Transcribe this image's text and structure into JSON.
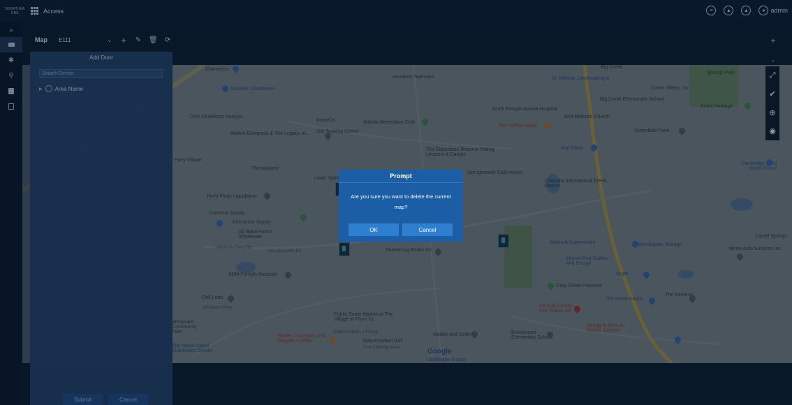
{
  "topbar": {
    "logo_text": "SIGNATURA ONE",
    "app_title": "Access",
    "user": "admin",
    "icons": [
      "chat-icon",
      "bell-icon",
      "alarm-icon",
      "user-icon"
    ]
  },
  "rail": {
    "collapse_label": "»",
    "items": [
      "door-icon",
      "settings-icon",
      "person-icon",
      "document-icon",
      "device-icon"
    ]
  },
  "toolbar": {
    "map_label": "Map",
    "map_select_value": "E111",
    "dropdown_glyph": "⌄",
    "add_glyph": "+",
    "edit_glyph": "✎",
    "delete_glyph": "🗑",
    "refresh_glyph": "⟳"
  },
  "panel": {
    "title": "Add Door",
    "search_placeholder": "Search Device",
    "tree_root": "Area Name",
    "submit_label": "Submit",
    "cancel_label": "Cancel"
  },
  "map": {
    "labels": [
      {
        "text": "Chemetics",
        "kind": "plain"
      },
      {
        "text": "Superior Distribution",
        "kind": "blue"
      },
      {
        "text": "Southern Staircase",
        "kind": "plain"
      },
      {
        "text": "BL Millman Landscaping &",
        "kind": "blue"
      },
      {
        "text": "Big Creek",
        "kind": "plain"
      },
      {
        "text": "Big Creek Elementary School",
        "kind": "plain"
      },
      {
        "text": "Cotter Sitters, Inc",
        "kind": "plain"
      },
      {
        "text": "Springs Park",
        "kind": "plain"
      },
      {
        "text": "Johns Heritage",
        "kind": "plain"
      },
      {
        "text": "CMX CineBistro Halcyon",
        "kind": "plain"
      },
      {
        "text": "Walton Bluegrass & The Legacy at...",
        "kind": "plain"
      },
      {
        "text": "RaiseOx",
        "kind": "plain"
      },
      {
        "text": "GM Training Center",
        "kind": "plain"
      },
      {
        "text": "Atlanta Recreation Club",
        "kind": "plain"
      },
      {
        "text": "South Forsyth Animal Hospital",
        "kind": "plain"
      },
      {
        "text": "The Coffee Lodge",
        "kind": "red"
      },
      {
        "text": "Bird-Bedrock Church",
        "kind": "plain"
      },
      {
        "text": "Greenfield Farm",
        "kind": "plain"
      },
      {
        "text": "Fairy Village",
        "kind": "plain"
      },
      {
        "text": "Therapyland",
        "kind": "plain"
      },
      {
        "text": "Laser Spine",
        "kind": "plain"
      },
      {
        "text": "The Equestrian Reserve Riding Lessons & Camps",
        "kind": "plain"
      },
      {
        "text": "Springmeade Club House",
        "kind": "plain"
      },
      {
        "text": "Any Glass",
        "kind": "blue"
      },
      {
        "text": "Cambridge Hard Wood Floors",
        "kind": "blue"
      },
      {
        "text": "Cherians International Fresh Market",
        "kind": "plain"
      },
      {
        "text": "Perfe Finds Liquidation",
        "kind": "plain"
      },
      {
        "text": "Lummus Supply",
        "kind": "plain"
      },
      {
        "text": "Johnstone Supply",
        "kind": "plain"
      },
      {
        "text": "All Baba Farms Wholesale",
        "kind": "plain"
      },
      {
        "text": "McGinnis Ferry Rd",
        "kind": "road"
      },
      {
        "text": "Old Alpharetta Rd",
        "kind": "road"
      },
      {
        "text": "Shelterring Books Inc",
        "kind": "plain"
      },
      {
        "text": "Walmart Supercenter",
        "kind": "blue"
      },
      {
        "text": "Morningstar Storage",
        "kind": "blue"
      },
      {
        "text": "Laurel Springs",
        "kind": "plain"
      },
      {
        "text": "Metro Auto Services Inc",
        "kind": "plain"
      },
      {
        "text": "Atlanta Rug Gallery And Design",
        "kind": "blue"
      },
      {
        "text": "Target",
        "kind": "blue"
      },
      {
        "text": "Grey Creek Preserve",
        "kind": "plain"
      },
      {
        "text": "The Home Depot",
        "kind": "blue"
      },
      {
        "text": "The Reserve",
        "kind": "plain"
      },
      {
        "text": "Forsyth County Fire Station #8",
        "kind": "red"
      },
      {
        "text": "Sprigg-N-Bites by Mamsi Savoyer",
        "kind": "red"
      },
      {
        "text": "ADM Forsyth Services",
        "kind": "plain"
      },
      {
        "text": "Chill Lotte",
        "kind": "plain"
      },
      {
        "text": "Windward Pkwy",
        "kind": "road"
      },
      {
        "text": "Windward Community Park",
        "kind": "plain"
      },
      {
        "text": "The Home Depot Distribution Center",
        "kind": "blue"
      },
      {
        "text": "Publix Super Market at The Village at Flynn Cr...",
        "kind": "plain"
      },
      {
        "text": "Publix Delivery • Pickup",
        "kind": "road"
      },
      {
        "text": "Bottles Cupcakes and Beignet Truffles",
        "kind": "red"
      },
      {
        "text": "Mayuri Indian Grill",
        "kind": "plain"
      },
      {
        "text": "Fast Catering Menu",
        "kind": "road"
      },
      {
        "text": "Marble and Order",
        "kind": "plain"
      },
      {
        "text": "Brookwood Elementary School",
        "kind": "plain"
      },
      {
        "text": "Google",
        "kind": "blue"
      },
      {
        "text": "Landscape Supply",
        "kind": "blue"
      }
    ]
  },
  "map_tools": [
    "fullscreen-icon",
    "check-icon",
    "plus-circle-icon",
    "locate-icon"
  ],
  "zoom": {
    "in": "+",
    "out": "-"
  },
  "dialog": {
    "title": "Prompt",
    "message": "Are you sure you want to delete the current map?",
    "ok_label": "OK",
    "cancel_label": "Cancel"
  },
  "colors": {
    "topbar": "#0d1d33",
    "dialog": "#1b5ea6",
    "dialog_button": "#2f7fd0",
    "panel": "#22406a"
  }
}
